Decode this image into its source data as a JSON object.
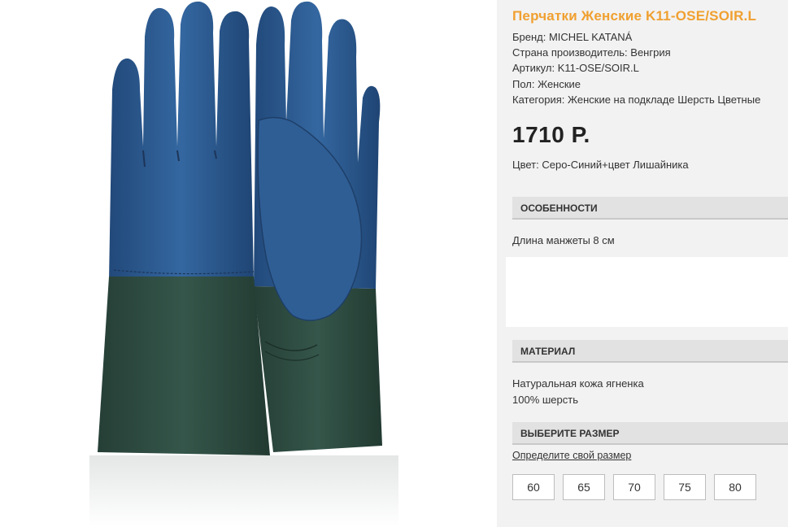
{
  "product": {
    "title": "Перчатки Женские K11-OSE/SOIR.L",
    "specs": [
      "Бренд: MICHEL KATANÁ",
      "Страна производитель: Венгрия",
      "Артикул: K11-OSE/SOIR.L",
      "Пол: Женские",
      "Категория: Женские на подкладе Шерсть Цветные"
    ],
    "price": "1710 Р.",
    "color": "Цвет: Серо-Синий+цвет Лишайника"
  },
  "features": {
    "header": "ОСОБЕННОСТИ",
    "text": "Длина манжеты 8 см"
  },
  "material": {
    "header": "МАТЕРИАЛ",
    "items": [
      "Натуральная кожа ягненка",
      "100% шерсть"
    ]
  },
  "size": {
    "header": "ВЫБЕРИТЕ РАЗМЕР",
    "link": "Определите свой размер",
    "options": [
      "60",
      "65",
      "70",
      "75",
      "80"
    ]
  },
  "colors": {
    "title_accent": "#f0a030",
    "glove_blue": "#2c5a8e",
    "glove_green": "#2e4b40",
    "panel_bg": "#f2f2f2"
  }
}
